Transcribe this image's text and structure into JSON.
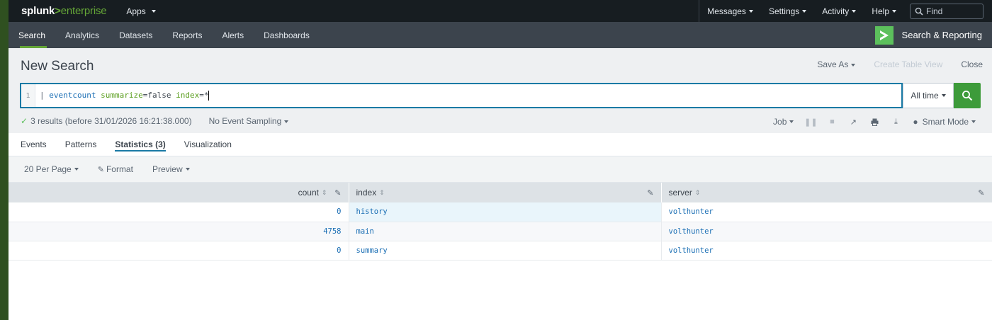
{
  "topbar": {
    "logo_brand": "splunk",
    "logo_gt": ">",
    "logo_product": "enterprise",
    "apps_label": "Apps",
    "menus": [
      "Messages",
      "Settings",
      "Activity",
      "Help"
    ],
    "find_placeholder": "Find"
  },
  "appbar": {
    "tabs": [
      "Search",
      "Analytics",
      "Datasets",
      "Reports",
      "Alerts",
      "Dashboards"
    ],
    "active_tab": "Search",
    "app_name": "Search & Reporting",
    "accent_color": "#65a637"
  },
  "header": {
    "title": "New Search",
    "save_as": "Save As",
    "create_table_view": "Create Table View",
    "close": "Close"
  },
  "search": {
    "line_number": "1",
    "query_pipe": "| ",
    "query_cmd": "eventcount",
    "query_arg1": " summarize",
    "query_val1": "=false",
    "query_arg2": " index",
    "query_val2": "=*",
    "time_range": "All time",
    "run_icon": "magnifier-icon"
  },
  "status": {
    "results_text": "3 results (before 31/01/2026 16:21:38.000)",
    "sampling": "No Event Sampling",
    "job_label": "Job",
    "mode": "Smart Mode"
  },
  "result_tabs": [
    "Events",
    "Patterns",
    "Statistics (3)",
    "Visualization"
  ],
  "active_result_tab": "Statistics (3)",
  "table_controls": {
    "per_page": "20 Per Page",
    "format": "Format",
    "preview": "Preview"
  },
  "table": {
    "columns": [
      "count",
      "index",
      "server"
    ],
    "rows": [
      [
        "0",
        "history",
        "volthunter"
      ],
      [
        "4758",
        "main",
        "volthunter"
      ],
      [
        "0",
        "summary",
        "volthunter"
      ]
    ]
  }
}
